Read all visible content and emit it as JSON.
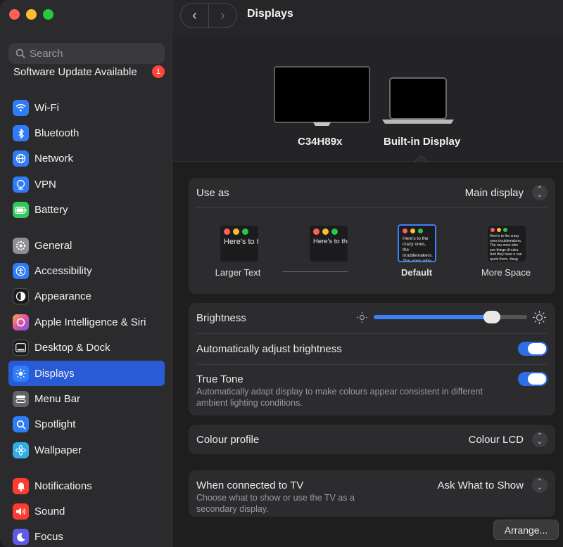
{
  "window": {
    "title": "Displays"
  },
  "sidebar": {
    "search_placeholder": "Search",
    "update_text": "Software Update Available",
    "update_count": "1",
    "items": [
      {
        "label": "Wi-Fi",
        "icon": "wifi-icon",
        "color": "#2f7cf6"
      },
      {
        "label": "Bluetooth",
        "icon": "bluetooth-icon",
        "color": "#2f7cf6"
      },
      {
        "label": "Network",
        "icon": "globe-icon",
        "color": "#2f7cf6"
      },
      {
        "label": "VPN",
        "icon": "vpn-icon",
        "color": "#2f7cf6"
      },
      {
        "label": "Battery",
        "icon": "battery-icon",
        "color": "#34c759"
      },
      {
        "label": "General",
        "icon": "gear-icon",
        "color": "#8e8e93"
      },
      {
        "label": "Accessibility",
        "icon": "accessibility-icon",
        "color": "#2f7cf6"
      },
      {
        "label": "Appearance",
        "icon": "appearance-icon",
        "color": "#1c1c1e"
      },
      {
        "label": "Apple Intelligence & Siri",
        "icon": "siri-icon",
        "color": "#c86dd7"
      },
      {
        "label": "Desktop & Dock",
        "icon": "dock-icon",
        "color": "#1c1c1e"
      },
      {
        "label": "Displays",
        "icon": "sun-icon",
        "color": "#2f7cf6"
      },
      {
        "label": "Menu Bar",
        "icon": "menubar-icon",
        "color": "#636366"
      },
      {
        "label": "Spotlight",
        "icon": "magnifier-icon",
        "color": "#2f7cf6"
      },
      {
        "label": "Wallpaper",
        "icon": "flower-icon",
        "color": "#32ade6"
      },
      {
        "label": "Notifications",
        "icon": "bell-icon",
        "color": "#ff3b30"
      },
      {
        "label": "Sound",
        "icon": "speaker-icon",
        "color": "#ff3b30"
      },
      {
        "label": "Focus",
        "icon": "moon-icon",
        "color": "#5e5ce6"
      }
    ]
  },
  "monitors": [
    {
      "label": "C34H89x"
    },
    {
      "label": "Built-in Display"
    }
  ],
  "use_as": {
    "label": "Use as",
    "value": "Main display"
  },
  "resolutions": [
    {
      "label": "Larger Text",
      "sample": "Here's to the crazy ones, the troublemakers",
      "selected": false
    },
    {
      "label": "",
      "sample": "Here's to the crazy ones, the troublemakers, ones who see things",
      "selected": false
    },
    {
      "label": "Default",
      "sample": "Here's to the crazy ones, the troublemakers. The ones who see things rules. And they",
      "selected": true
    },
    {
      "label": "More Space",
      "sample": "Here's to the crazy ones troublemakers. The rou ones who see things di rules. And they have n can quote them, disag them. About the only th Because they change t",
      "selected": false
    }
  ],
  "brightness": {
    "label": "Brightness",
    "level": 0.77
  },
  "auto_brightness": {
    "label": "Automatically adjust brightness",
    "on": true
  },
  "true_tone": {
    "label": "True Tone",
    "description": "Automatically adapt display to make colours appear consistent in different ambient lighting conditions.",
    "on": true
  },
  "colour_profile": {
    "label": "Colour profile",
    "value": "Colour LCD"
  },
  "tv": {
    "label": "When connected to TV",
    "value": "Ask What to Show",
    "description": "Choose what to show or use the TV as a secondary display."
  },
  "arrange_button": "Arrange..."
}
